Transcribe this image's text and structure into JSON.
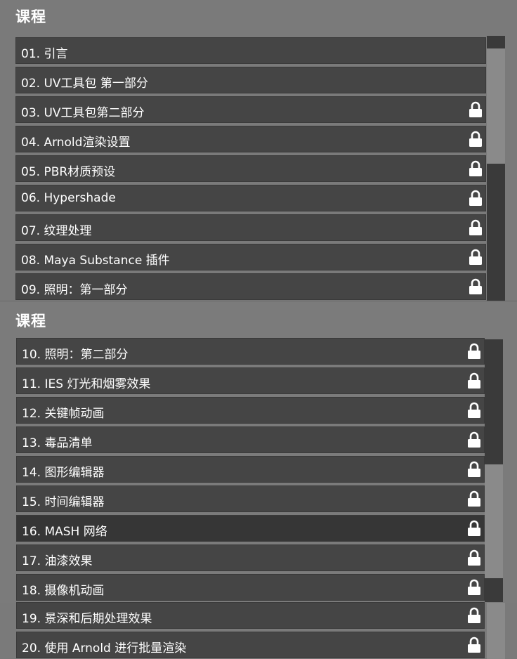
{
  "panels": [
    {
      "title": "课程",
      "items": [
        {
          "label": "01. 引言",
          "locked": false
        },
        {
          "label": "02. UV工具包 第一部分",
          "locked": false
        },
        {
          "label": "03. UV工具包第二部分",
          "locked": true
        },
        {
          "label": "04. Arnold渲染设置",
          "locked": true
        },
        {
          "label": "05. PBR材质预设",
          "locked": true
        },
        {
          "label": "06. Hypershade",
          "locked": true
        },
        {
          "label": "07. 纹理处理",
          "locked": true
        },
        {
          "label": "08. Maya Substance 插件",
          "locked": true
        },
        {
          "label": "09. 照明：第一部分",
          "locked": true
        }
      ]
    },
    {
      "title": "课程",
      "items": [
        {
          "label": "10. 照明：第二部分",
          "locked": true
        },
        {
          "label": "11. IES 灯光和烟雾效果",
          "locked": true
        },
        {
          "label": "12. 关键帧动画",
          "locked": true
        },
        {
          "label": "13. 毒品清单",
          "locked": true
        },
        {
          "label": "14. 图形编辑器",
          "locked": true
        },
        {
          "label": "15. 时间编辑器",
          "locked": true
        },
        {
          "label": "16. MASH 网络",
          "locked": true,
          "active": true
        },
        {
          "label": "17. 油漆效果",
          "locked": true
        },
        {
          "label": "18. 摄像机动画",
          "locked": true
        }
      ]
    },
    {
      "items": [
        {
          "label": "19. 景深和后期处理效果",
          "locked": true
        },
        {
          "label": "20. 使用 Arnold 进行批量渲染",
          "locked": true
        }
      ]
    }
  ],
  "icons": {
    "lock": "lock-icon"
  },
  "colors": {
    "row_bg": "#454545",
    "row_active_bg": "#363636",
    "page_bg": "#7a7a7a",
    "text": "#ffffff",
    "scroll_track": "#3a3a3a",
    "scroll_thumb": "#8a8a8a"
  }
}
